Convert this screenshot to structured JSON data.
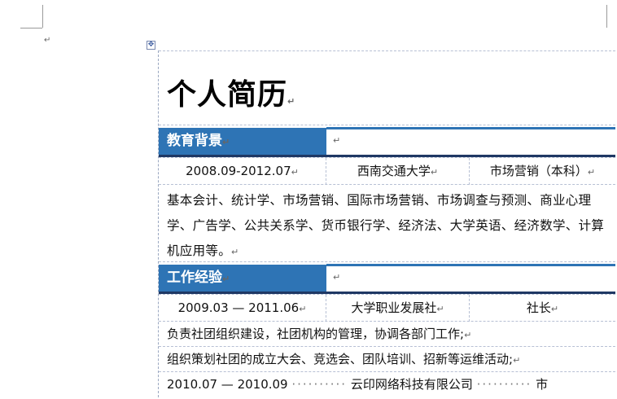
{
  "document": {
    "paragraph_mark": "↵",
    "title": "个人简历",
    "sections": {
      "education": {
        "label": "教育背景",
        "period": "2008.09-2012.07",
        "school": "西南交通大学",
        "major": "市场营销（本科）",
        "courses": "基本会计、统计学、市场营销、国际市场营销、市场调查与预测、商业心理学、广告学、公共关系学、货币银行学、经济法、大学英语、经济数学、计算机应用等。"
      },
      "work": {
        "label": "工作经验",
        "period": "2009.03 — 2011.06",
        "organization": "大学职业发展社",
        "position": "社长",
        "duty_1": "负责社团组织建设，社团机构的管理，协调各部门工作;",
        "duty_2": "组织策划社团的成立大会、竞选会、团队培训、招新等运维活动;",
        "job2_period": "2010.07 — 2010.09",
        "job2_company": "云印网络科技有限公司",
        "job2_role_partial": "市"
      }
    }
  },
  "icons": {
    "table_move_handle": "move-handle-icon"
  },
  "colors": {
    "section_fill": "#2e74b5",
    "section_rule": "#1f3864"
  }
}
